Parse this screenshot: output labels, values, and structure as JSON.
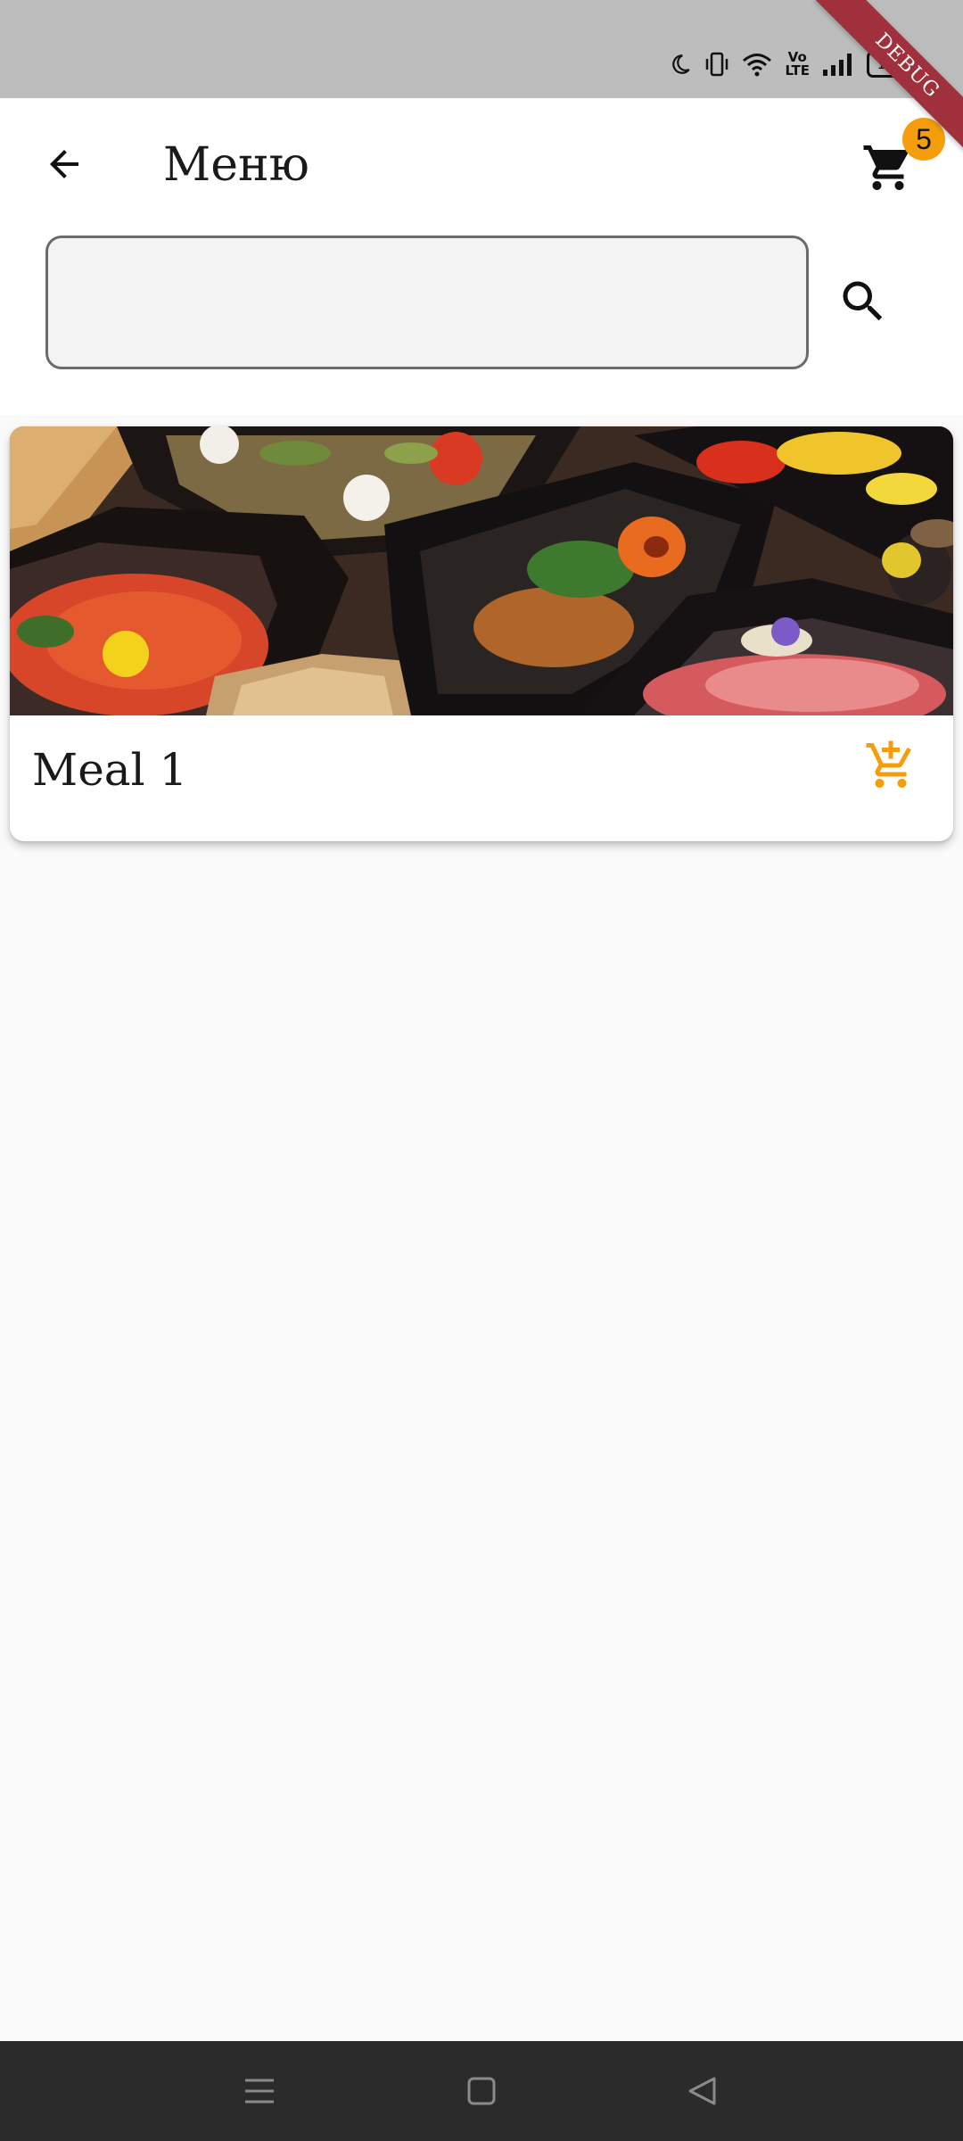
{
  "status_bar": {
    "battery_level": "100",
    "network_label_top": "Vo",
    "network_label_bottom": "LTE",
    "icons": [
      "moon-icon",
      "vibrate-icon",
      "wifi-icon",
      "volte-icon",
      "signal-icon",
      "battery-icon"
    ]
  },
  "debug_banner": {
    "label": "DEBUG"
  },
  "header": {
    "title": "Меню",
    "cart_count": "5",
    "back_icon": "arrow-back-icon",
    "cart_icon": "shopping-cart-icon"
  },
  "search": {
    "value": "",
    "placeholder": "",
    "icon": "search-icon"
  },
  "menu": {
    "items": [
      {
        "name": "Meal 1",
        "image": "meal-prep-containers-photo",
        "action_icon": "add-shopping-cart-icon"
      }
    ]
  },
  "colors": {
    "accent": "#f59e0b",
    "status_bar_bg": "#bdbdbd",
    "nav_bar_bg": "#2b2b2b",
    "debug_banner": "#a0303c",
    "page_bg": "#fafafa"
  },
  "nav_bar": {
    "icons": [
      "menu-icon",
      "home-icon",
      "back-icon"
    ]
  }
}
